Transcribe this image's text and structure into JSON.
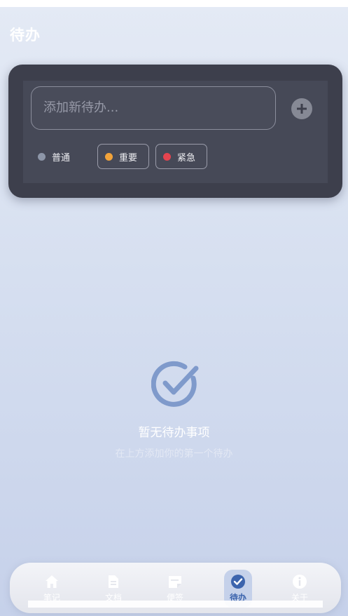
{
  "page": {
    "title": "待办"
  },
  "input": {
    "placeholder": "添加新待办..."
  },
  "priorities": [
    {
      "label": "普通",
      "color": "#8d96a8"
    },
    {
      "label": "重要",
      "color": "#f2a33a"
    },
    {
      "label": "紧急",
      "color": "#e5444f"
    }
  ],
  "empty": {
    "title": "暂无待办事项",
    "subtitle": "在上方添加你的第一个待办"
  },
  "nav": [
    {
      "label": "笔记",
      "icon": "home-icon"
    },
    {
      "label": "文档",
      "icon": "document-icon"
    },
    {
      "label": "便签",
      "icon": "note-icon"
    },
    {
      "label": "待办",
      "icon": "check-circle-icon",
      "active": true
    },
    {
      "label": "关于",
      "icon": "info-icon"
    }
  ],
  "colors": {
    "accent": "#3c64ad",
    "card": "#3d3f4c",
    "empty_icon": "#7f9acb"
  }
}
